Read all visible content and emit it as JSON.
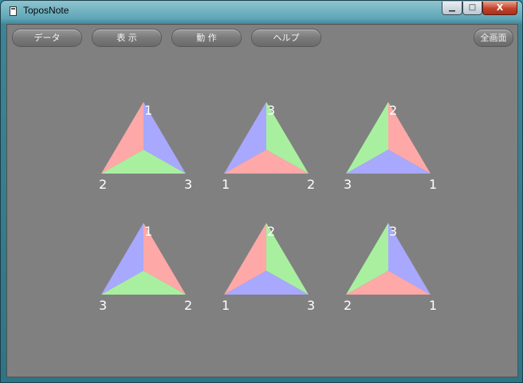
{
  "window": {
    "title": "ToposNote"
  },
  "controls": {
    "close": "X"
  },
  "toolbar": {
    "data_label": "データ",
    "display_label": "表 示",
    "action_label": "動 作",
    "help_label": "ヘルプ",
    "fullscreen_label": "全画面"
  },
  "colors": {
    "background": "#808080",
    "red": "#ffa8a8",
    "green": "#a8f0a0",
    "blue": "#a8a8ff",
    "label": "#ffffff"
  },
  "triangles": [
    {
      "top": "1",
      "left": "2",
      "right": "3",
      "sectors": [
        "red",
        "blue",
        "green"
      ]
    },
    {
      "top": "3",
      "left": "1",
      "right": "2",
      "sectors": [
        "blue",
        "green",
        "red"
      ]
    },
    {
      "top": "2",
      "left": "3",
      "right": "1",
      "sectors": [
        "green",
        "red",
        "blue"
      ]
    },
    {
      "top": "1",
      "left": "3",
      "right": "2",
      "sectors": [
        "blue",
        "red",
        "green"
      ]
    },
    {
      "top": "2",
      "left": "1",
      "right": "3",
      "sectors": [
        "red",
        "green",
        "blue"
      ]
    },
    {
      "top": "3",
      "left": "2",
      "right": "1",
      "sectors": [
        "green",
        "blue",
        "red"
      ]
    }
  ]
}
